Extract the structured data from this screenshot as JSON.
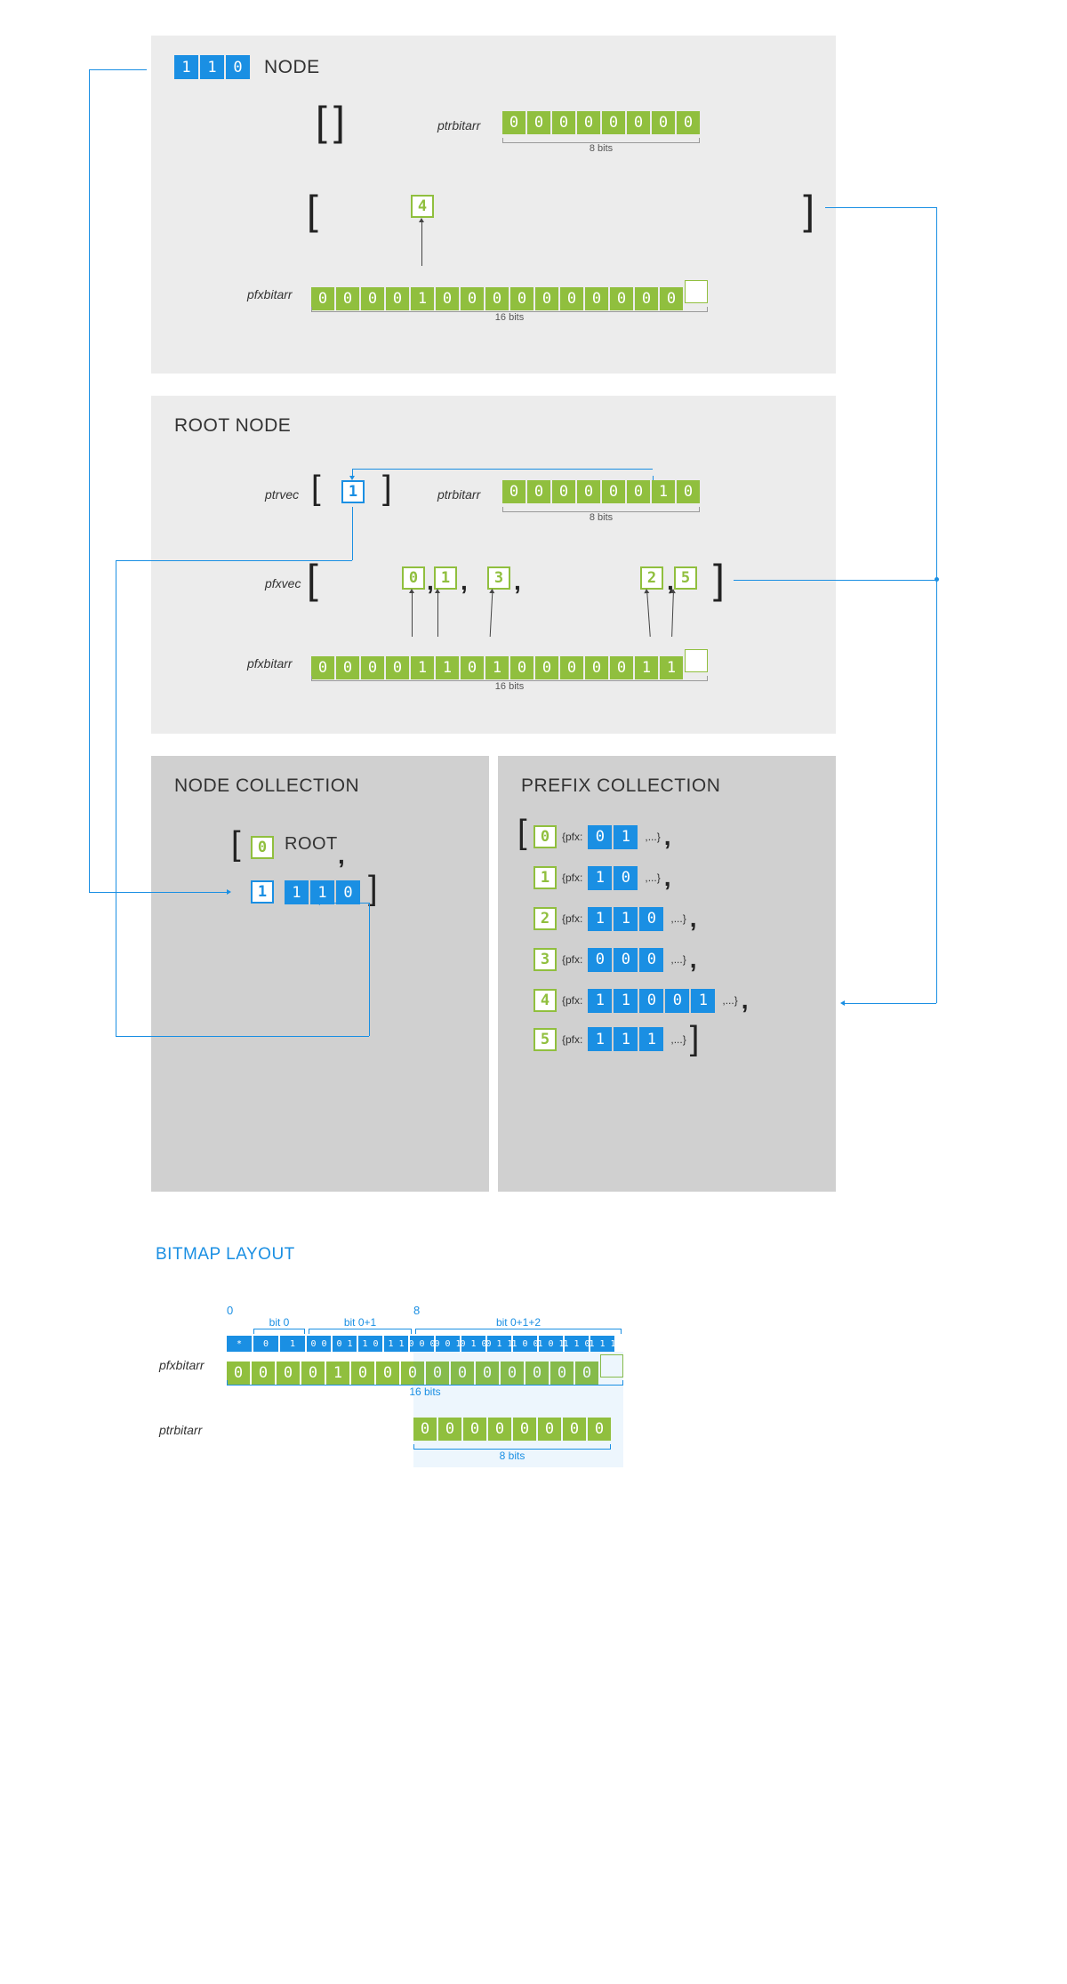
{
  "node_panel": {
    "title": "NODE",
    "title_bits": [
      "1",
      "1",
      "0"
    ],
    "ptrbitarr_label": "ptrbitarr",
    "ptrbitarr": [
      "0",
      "0",
      "0",
      "0",
      "0",
      "0",
      "0",
      "0"
    ],
    "ptrbitarr_width": "8 bits",
    "pfxvec_pointer": "4",
    "pfxbitarr_label": "pfxbitarr",
    "pfxbitarr": [
      "0",
      "0",
      "0",
      "0",
      "1",
      "0",
      "0",
      "0",
      "0",
      "0",
      "0",
      "0",
      "0",
      "0",
      "0"
    ],
    "pfxbitarr_width": "16 bits"
  },
  "root_panel": {
    "title": "ROOT NODE",
    "ptrvec_label": "ptrvec",
    "ptrvec": [
      "1"
    ],
    "ptrbitarr_label": "ptrbitarr",
    "ptrbitarr": [
      "0",
      "0",
      "0",
      "0",
      "0",
      "0",
      "1",
      "0"
    ],
    "ptrbitarr_width": "8 bits",
    "pfxvec_label": "pfxvec",
    "pfxvec": [
      "0",
      "1",
      "3",
      "2",
      "5"
    ],
    "pfxbitarr_label": "pfxbitarr",
    "pfxbitarr": [
      "0",
      "0",
      "0",
      "0",
      "1",
      "1",
      "0",
      "1",
      "0",
      "0",
      "0",
      "0",
      "0",
      "1",
      "1"
    ],
    "pfxbitarr_width": "16 bits"
  },
  "node_collection": {
    "title": "NODE COLLECTION",
    "items": [
      {
        "index": "0",
        "label": "ROOT"
      },
      {
        "index": "1",
        "bits": [
          "1",
          "1",
          "0"
        ]
      }
    ]
  },
  "prefix_collection": {
    "title": "PREFIX COLLECTION",
    "pfx_label": "{pfx:",
    "items": [
      {
        "index": "0",
        "bits": [
          "0",
          "1"
        ]
      },
      {
        "index": "1",
        "bits": [
          "1",
          "0"
        ]
      },
      {
        "index": "2",
        "bits": [
          "1",
          "1",
          "0"
        ]
      },
      {
        "index": "3",
        "bits": [
          "0",
          "0",
          "0"
        ]
      },
      {
        "index": "4",
        "bits": [
          "1",
          "1",
          "0",
          "0",
          "1"
        ]
      },
      {
        "index": "5",
        "bits": [
          "1",
          "1",
          "1"
        ]
      }
    ],
    "suffix": ",...}"
  },
  "bitmap_layout": {
    "title": "BITMAP LAYOUT",
    "marker_0": "0",
    "marker_8": "8",
    "groups": [
      "bit 0",
      "bit 0+1",
      "bit 0+1+2"
    ],
    "header_cells": [
      "*",
      "0",
      "1",
      "0 0",
      "0 1",
      "1 0",
      "1 1",
      "0 0 0",
      "0 0 1",
      "0 1 0",
      "0 1 1",
      "1 0 0",
      "1 0 1",
      "1 1 0",
      "1 1 1"
    ],
    "pfxbitarr_label": "pfxbitarr",
    "pfxbitarr": [
      "0",
      "0",
      "0",
      "0",
      "1",
      "0",
      "0",
      "0",
      "0",
      "0",
      "0",
      "0",
      "0",
      "0",
      "0"
    ],
    "pfxbitarr_width": "16 bits",
    "ptrbitarr_label": "ptrbitarr",
    "ptrbitarr": [
      "0",
      "0",
      "0",
      "0",
      "0",
      "0",
      "0",
      "0"
    ],
    "ptrbitarr_width": "8 bits"
  }
}
